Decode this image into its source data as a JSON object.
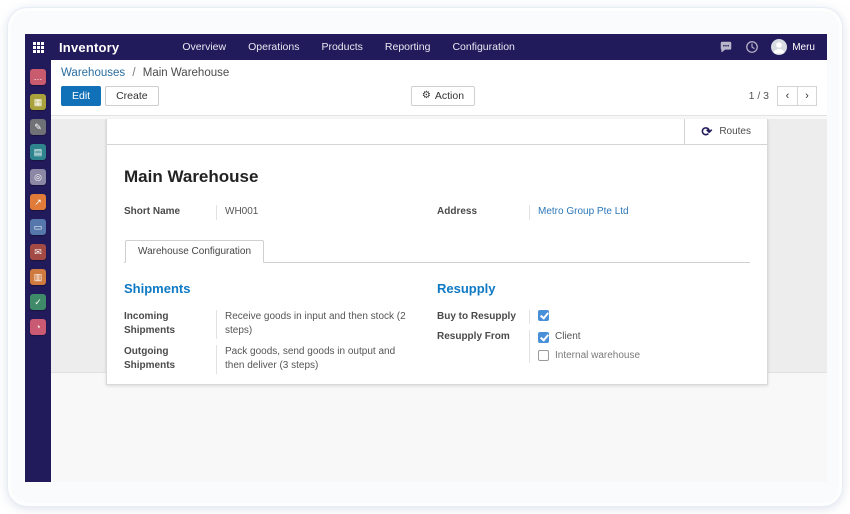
{
  "navbar": {
    "app_name": "Inventory",
    "menu_items": {
      "0": "Overview",
      "1": "Operations",
      "2": "Products",
      "3": "Reporting",
      "4": "Configuration"
    },
    "user_name": "Meru"
  },
  "sidebar": {
    "apps": {
      "0": {
        "name": "discuss",
        "color": "#c95b6f",
        "glyph": "…"
      },
      "1": {
        "name": "calendar",
        "color": "#a9a13c",
        "glyph": "▦"
      },
      "2": {
        "name": "notes",
        "color": "#6e7277",
        "glyph": "✎"
      },
      "3": {
        "name": "contacts",
        "color": "#2f858d",
        "glyph": "▤"
      },
      "4": {
        "name": "crm",
        "color": "#8b87a5",
        "glyph": "◎"
      },
      "5": {
        "name": "sales",
        "color": "#e07b3a",
        "glyph": "↗"
      },
      "6": {
        "name": "point-of-sale",
        "color": "#5577ab",
        "glyph": "▭"
      },
      "7": {
        "name": "email-marketing",
        "color": "#a34a44",
        "glyph": "✉"
      },
      "8": {
        "name": "purchase",
        "color": "#cf7a3f",
        "glyph": "▥"
      },
      "9": {
        "name": "inventory",
        "color": "#3f8a68",
        "glyph": "✓"
      },
      "10": {
        "name": "dashboards",
        "color": "#ca5a73",
        "glyph": "◔"
      }
    }
  },
  "control_panel": {
    "breadcrumb": {
      "parent": "Warehouses",
      "separator": "/",
      "current": "Main Warehouse"
    },
    "edit_label": "Edit",
    "create_label": "Create",
    "action_label": "Action",
    "gear_glyph": "⚙",
    "pager": {
      "count": "1 / 3",
      "prev": "‹",
      "next": "›"
    }
  },
  "form": {
    "button_box": {
      "routes_label": "Routes",
      "refresh_glyph": "⟳"
    },
    "title": "Main Warehouse",
    "fields": {
      "short_name": {
        "label": "Short Name",
        "value": "WH001"
      },
      "address": {
        "label": "Address",
        "value": "Metro Group Pte Ltd"
      }
    },
    "tabs": {
      "0": {
        "label": "Warehouse Configuration"
      }
    },
    "shipments": {
      "heading": "Shipments",
      "incoming": {
        "label": "Incoming Shipments",
        "value": "Receive goods in input and then stock (2 steps)"
      },
      "outgoing": {
        "label": "Outgoing Shipments",
        "value": "Pack goods, send goods in output and then deliver (3 steps)"
      }
    },
    "resupply": {
      "heading": "Resupply",
      "buy_to_resupply": {
        "label": "Buy to Resupply",
        "checked": true
      },
      "resupply_from": {
        "label": "Resupply From",
        "options": {
          "0": {
            "label": "Client",
            "checked": true
          },
          "1": {
            "label": "Internal warehouse",
            "checked": false
          }
        }
      }
    }
  },
  "colors": {
    "navbar_bg": "#221b5b",
    "primary_button": "#1071b8",
    "section_heading": "#0e79c4",
    "link": "#2c77b8",
    "checkbox_checked": "#4a90d9"
  }
}
